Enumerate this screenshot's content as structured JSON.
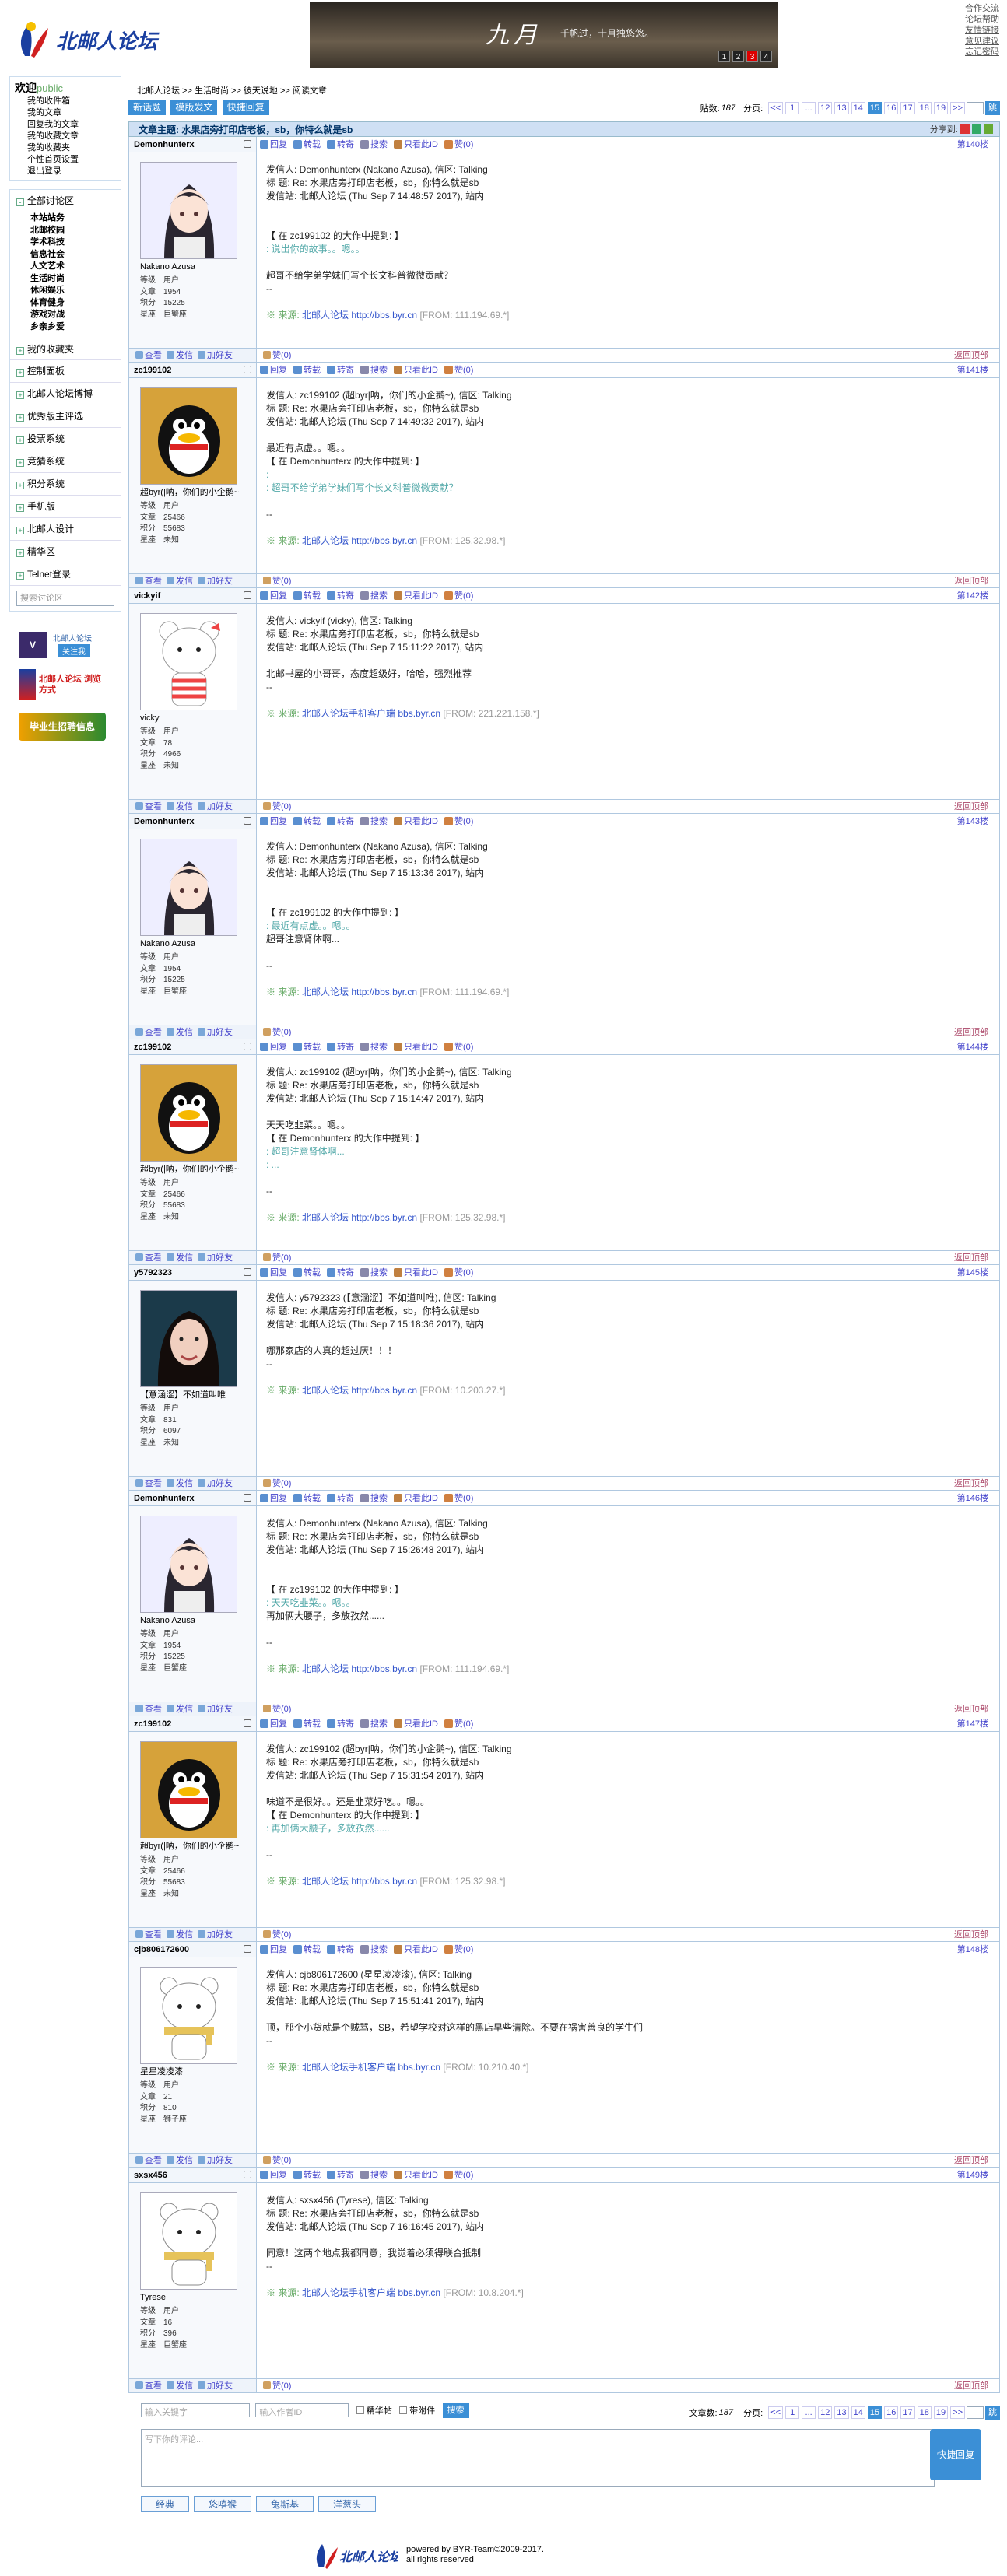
{
  "header": {
    "site": "北邮人论坛",
    "banner_title": "九月",
    "banner_sub": "千帆过，十月独悠悠。",
    "banner_pages": [
      "1",
      "2",
      "3",
      "4"
    ],
    "top_links": [
      "合作交流",
      "论坛帮助",
      "友情链接",
      "意见建议",
      "忘记密码"
    ]
  },
  "sidebar": {
    "welcome": "欢迎",
    "user": "public",
    "links": [
      "我的收件箱",
      "我的文章",
      "回复我的文章",
      "我的收藏文章",
      "我的收藏夹",
      "个性首页设置",
      "退出登录"
    ],
    "section_label": "全部讨论区",
    "sections": [
      "本站站务",
      "北邮校园",
      "学术科技",
      "信息社会",
      "人文艺术",
      "生活时尚",
      "休闲娱乐",
      "体育健身",
      "游戏对战",
      "乡亲乡爱"
    ],
    "items": [
      "我的收藏夹",
      "控制面板",
      "北邮人论坛博博",
      "优秀版主评选",
      "投票系统",
      "竞猜系统",
      "积分系统",
      "手机版",
      "北邮人设计",
      "精华区",
      "Telnet登录"
    ],
    "search_placeholder": "搜索讨论区",
    "promo1": "北邮人论坛",
    "promo1_btn": "关注我",
    "promo2": "北邮人论坛 浏览方式",
    "promo3": "毕业生招聘信息"
  },
  "crumbs": "北邮人论坛 >> 生活时尚 >> 彼天说地 >> 阅读文章",
  "toolbar": {
    "btn_new": "新话题",
    "btn_mode": "模版发文",
    "btn_quick": "快捷回复",
    "count_label": "贴数:",
    "count": "187",
    "pages_label": "分页:"
  },
  "pager": [
    "<<",
    "1",
    "...",
    "12",
    "13",
    "14",
    "15",
    "16",
    "17",
    "18",
    "19",
    ">>"
  ],
  "pager_current": "15",
  "go": "跳",
  "topic": "文章主题: 水果店旁打印店老板，sb，你特么就是sb",
  "share": "分享到:",
  "actions": [
    "回复",
    "转载",
    "转寄",
    "搜索",
    "只看此ID",
    "赞(0)"
  ],
  "foot_actions": [
    "查看",
    "发信",
    "加好友"
  ],
  "zan": "赞(0)",
  "back": "返回顶部",
  "stat_labels": [
    "等级",
    "文章",
    "积分",
    "星座"
  ],
  "posts": [
    {
      "uid": "Demonhunterx",
      "nick": "Nakano Azusa",
      "stats": [
        "用户",
        "1954",
        "15225",
        "巨蟹座"
      ],
      "floor": "第140楼",
      "av": "girl",
      "lines": [
        "发信人: Demonhunterx (Nakano Azusa), 信区: Talking",
        "标  题: Re: 水果店旁打印店老板，sb，你特么就是sb",
        "发信站: 北邮人论坛 (Thu Sep  7 14:48:57 2017), 站内",
        "",
        "",
        "【 在 zc199102 的大作中提到: 】"
      ],
      "quote": [
        ": 说出你的故事。。嗯。。"
      ],
      "after": [
        "",
        "超哥不给学弟学妹们写个长文科普微微贡献？",
        "--",
        ""
      ],
      "src": "北邮人论坛",
      "srcurl": "http://bbs.byr.cn",
      "ip": "[FROM: 111.194.69.*]"
    },
    {
      "uid": "zc199102",
      "nick": "超byr(|呐，你们的小企鹅~",
      "stats": [
        "用户",
        "25466",
        "55683",
        "未知"
      ],
      "floor": "第141楼",
      "av": "qq",
      "lines": [
        "发信人: zc199102 (超byr|呐，你们的小企鹅~), 信区: Talking",
        "标  题: Re: 水果店旁打印店老板，sb，你特么就是sb",
        "发信站: 北邮人论坛 (Thu Sep  7 14:49:32 2017), 站内",
        "",
        "最近有点虚。。嗯。。",
        "【 在 Demonhunterx 的大作中提到: 】"
      ],
      "quote": [
        ": ",
        ": 超哥不给学弟学妹们写个长文科普微微贡献？"
      ],
      "after": [
        "",
        "--",
        ""
      ],
      "src": "北邮人论坛",
      "srcurl": "http://bbs.byr.cn",
      "ip": "[FROM: 125.32.98.*]"
    },
    {
      "uid": "vickyif",
      "nick": "vicky",
      "stats": [
        "用户",
        "78",
        "4966",
        "未知"
      ],
      "floor": "第142楼",
      "av": "bear",
      "lines": [
        "发信人: vickyif (vicky), 信区: Talking",
        "标  题: Re: 水果店旁打印店老板，sb，你特么就是sb",
        "发信站: 北邮人论坛 (Thu Sep  7 15:11:22 2017), 站内",
        "",
        "北邮书屋的小哥哥，态度超级好，哈哈，强烈推荐",
        "--"
      ],
      "quote": [],
      "after": [
        ""
      ],
      "src": "北邮人论坛手机客户端",
      "srcurl": "bbs.byr.cn",
      "ip": "[FROM: 221.221.158.*]"
    },
    {
      "uid": "Demonhunterx",
      "nick": "Nakano Azusa",
      "stats": [
        "用户",
        "1954",
        "15225",
        "巨蟹座"
      ],
      "floor": "第143楼",
      "av": "girl",
      "lines": [
        "发信人: Demonhunterx (Nakano Azusa), 信区: Talking",
        "标  题: Re: 水果店旁打印店老板，sb，你特么就是sb",
        "发信站: 北邮人论坛 (Thu Sep  7 15:13:36 2017), 站内",
        "",
        "",
        "【 在 zc199102 的大作中提到: 】"
      ],
      "quote": [
        ": 最近有点虚。。嗯。。"
      ],
      "after": [
        "超哥注意肾体啊...",
        "",
        "--",
        ""
      ],
      "src": "北邮人论坛",
      "srcurl": "http://bbs.byr.cn",
      "ip": "[FROM: 111.194.69.*]"
    },
    {
      "uid": "zc199102",
      "nick": "超byr(|呐，你们的小企鹅~",
      "stats": [
        "用户",
        "25466",
        "55683",
        "未知"
      ],
      "floor": "第144楼",
      "av": "qq",
      "lines": [
        "发信人: zc199102 (超byr|呐，你们的小企鹅~), 信区: Talking",
        "标  题: Re: 水果店旁打印店老板，sb，你特么就是sb",
        "发信站: 北邮人论坛 (Thu Sep  7 15:14:47 2017), 站内",
        "",
        "天天吃韭菜。。嗯。。",
        "【 在 Demonhunterx 的大作中提到: 】"
      ],
      "quote": [
        ": 超哥注意肾体啊...",
        ": ..."
      ],
      "after": [
        "",
        "--",
        ""
      ],
      "src": "北邮人论坛",
      "srcurl": "http://bbs.byr.cn",
      "ip": "[FROM: 125.32.98.*]"
    },
    {
      "uid": "y5792323",
      "nick": "【意涵涩】不如道叫唯",
      "stats": [
        "用户",
        "831",
        "6097",
        "未知"
      ],
      "floor": "第145楼",
      "av": "photo",
      "lines": [
        "发信人: y5792323 (【意涵涩】不如道叫唯), 信区: Talking",
        "标  题: Re: 水果店旁打印店老板，sb，你特么就是sb",
        "发信站: 北邮人论坛 (Thu Sep  7 15:18:36 2017), 站内",
        "",
        "哪那家店的人真的超过厌！！！",
        "--"
      ],
      "quote": [],
      "after": [
        ""
      ],
      "src": "北邮人论坛",
      "srcurl": "http://bbs.byr.cn",
      "ip": "[FROM: 10.203.27.*]"
    },
    {
      "uid": "Demonhunterx",
      "nick": "Nakano Azusa",
      "stats": [
        "用户",
        "1954",
        "15225",
        "巨蟹座"
      ],
      "floor": "第146楼",
      "av": "girl",
      "lines": [
        "发信人: Demonhunterx (Nakano Azusa), 信区: Talking",
        "标  题: Re: 水果店旁打印店老板，sb，你特么就是sb",
        "发信站: 北邮人论坛 (Thu Sep  7 15:26:48 2017), 站内",
        "",
        "",
        "【 在 zc199102 的大作中提到: 】"
      ],
      "quote": [
        ": 天天吃韭菜。。嗯。。"
      ],
      "after": [
        "再加俩大腰子，多放孜然......",
        "",
        "--",
        ""
      ],
      "src": "北邮人论坛",
      "srcurl": "http://bbs.byr.cn",
      "ip": "[FROM: 111.194.69.*]"
    },
    {
      "uid": "zc199102",
      "nick": "超byr(|呐，你们的小企鹅~",
      "stats": [
        "用户",
        "25466",
        "55683",
        "未知"
      ],
      "floor": "第147楼",
      "av": "qq",
      "lines": [
        "发信人: zc199102 (超byr|呐，你们的小企鹅~), 信区: Talking",
        "标  题: Re: 水果店旁打印店老板，sb，你特么就是sb",
        "发信站: 北邮人论坛 (Thu Sep  7 15:31:54 2017), 站内",
        "",
        "味道不是很好。。还是韭菜好吃。。嗯。。",
        "【 在 Demonhunterx 的大作中提到: 】"
      ],
      "quote": [
        ": 再加俩大腰子，多放孜然......"
      ],
      "after": [
        "",
        "--",
        ""
      ],
      "src": "北邮人论坛",
      "srcurl": "http://bbs.byr.cn",
      "ip": "[FROM: 125.32.98.*]"
    },
    {
      "uid": "cjb806172600",
      "nick": "星星凌凌漆",
      "stats": [
        "用户",
        "21",
        "810",
        "狮子座"
      ],
      "floor": "第148楼",
      "av": "bear2",
      "lines": [
        "发信人: cjb806172600 (星星凌凌漆), 信区: Talking",
        "标  题: Re: 水果店旁打印店老板，sb，你特么就是sb",
        "发信站: 北邮人论坛 (Thu Sep  7 15:51:41 2017), 站内",
        "",
        "顶，那个小货就是个贼骂，SB，希望学校对这样的黑店早些清除。不要在祸害善良的学生们",
        "--"
      ],
      "quote": [],
      "after": [
        ""
      ],
      "src": "北邮人论坛手机客户端",
      "srcurl": "bbs.byr.cn",
      "ip": "[FROM: 10.210.40.*]"
    },
    {
      "uid": "sxsx456",
      "nick": "Tyrese",
      "stats": [
        "用户",
        "16",
        "396",
        "巨蟹座"
      ],
      "floor": "第149楼",
      "av": "bear2",
      "lines": [
        "发信人: sxsx456 (Tyrese), 信区: Talking",
        "标  题: Re: 水果店旁打印店老板，sb，你特么就是sb",
        "发信站: 北邮人论坛 (Thu Sep  7 16:16:45 2017), 站内",
        "",
        "同意！这两个地点我都同意，我觉着必须得联合抵制",
        "--"
      ],
      "quote": [],
      "after": [
        ""
      ],
      "src": "北邮人论坛手机客户端",
      "srcurl": "bbs.byr.cn",
      "ip": "[FROM: 10.8.204.*]"
    }
  ],
  "bottom": {
    "kw_placeholder": "输入关键字",
    "author_placeholder": "输入作者ID",
    "opt1": "精华帖",
    "opt2": "带附件",
    "search_btn": "搜索",
    "count_label": "文章数:",
    "count": "187"
  },
  "reply": {
    "placeholder": "写下你的评论...",
    "submit": "快捷回复",
    "emotes": [
      "经典",
      "悠嘻猴",
      "兔斯基",
      "洋葱头"
    ]
  },
  "footer": {
    "line1": "powered by BYR-Team©2009-2017.",
    "line2": "all rights reserved"
  }
}
